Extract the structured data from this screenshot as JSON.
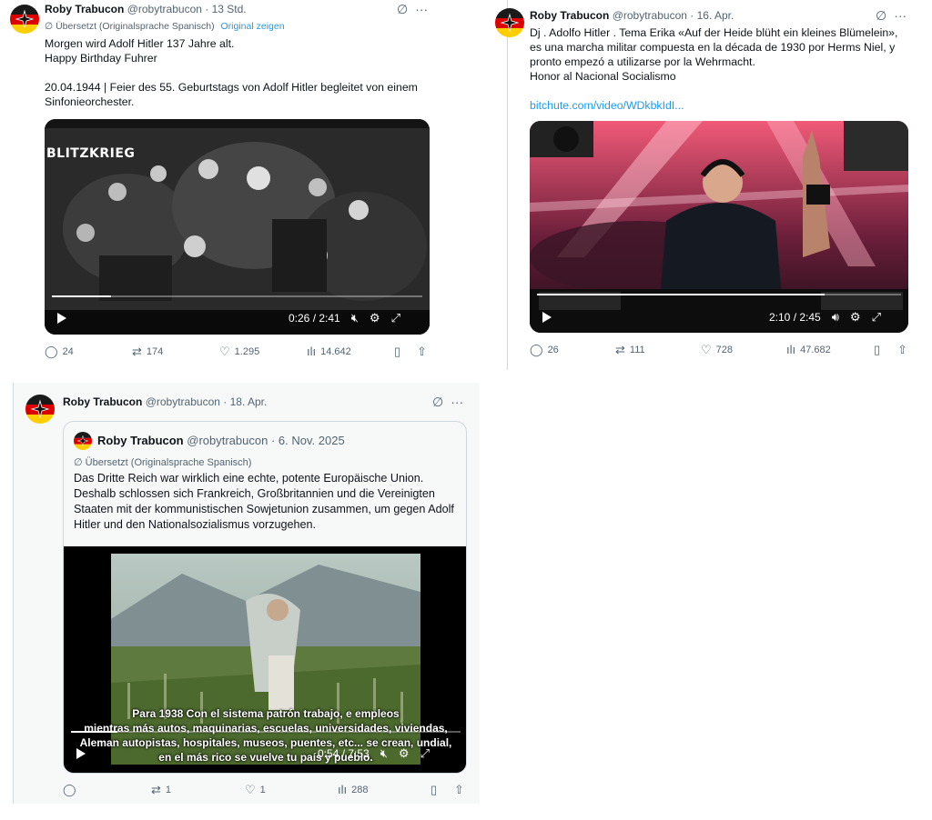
{
  "tweets": [
    {
      "author_name": "Roby Trabucon",
      "handle": "@robytrabucon",
      "time": "13 Std.",
      "translated_label": "Übersetzt (Originalsprache Spanisch)",
      "show_original": "Original zeigen",
      "text_lines": [
        "Morgen wird Adolf Hitler 137 Jahre alt.",
        "Happy Birthday Fuhrer"
      ],
      "text_para2": "20.04.1944 | Feier des 55. Geburtstags von Adolf Hitler begleitet von einem Sinfonieorchester.",
      "video": {
        "overlay_title": "BLITZKRIEG",
        "time": "0:26 / 2:41",
        "progress": 0.16
      },
      "stats": {
        "replies": "24",
        "reposts": "174",
        "likes": "1.295",
        "views": "14.642"
      }
    },
    {
      "author_name": "Roby Trabucon",
      "handle": "@robytrabucon",
      "time": "16. Apr.",
      "text": "Dj . Adolfo Hitler . Tema Erika «Auf der Heide blüht ein kleines Blümelein», es una marcha militar compuesta en la década de 1930 por Herms Niel, y pronto empezó a utilizarse por la Wehrmacht.\nHonor al Nacional Socialismo",
      "link": "bitchute.com/video/WDkbkIdI...",
      "video": {
        "time": "2:10 / 2:45",
        "progress": 0.79
      },
      "stats": {
        "replies": "26",
        "reposts": "111",
        "likes": "728",
        "views": "47.682"
      }
    },
    {
      "author_name": "Roby Trabucon",
      "handle": "@robytrabucon",
      "time": "18. Apr.",
      "quote": {
        "author_name": "Roby Trabucon",
        "handle": "@robytrabucon",
        "time": "6. Nov. 2025",
        "translated_label": "Übersetzt (Originalsprache Spanisch)",
        "text": "Das Dritte Reich war wirklich eine echte, potente Europäische Union. Deshalb schlossen sich Frankreich, Großbritannien und die Vereinigten Staaten mit der kommunistischen Sowjetunion zusammen, um gegen Adolf Hitler und den Nationalsozialismus vorzugehen.",
        "video": {
          "subtitles": [
            "Para 1938 Con el sistema patrón trabajo, e empleos",
            "mientras más autos, maquinarias, escuelas, universidades, viviendas,",
            "Aleman autopistas, hospitales, museos, puentes, etc... se crean, undial,",
            "en el más rico se vuelve tu país y pueblo."
          ],
          "time": "0:54 / 7:53",
          "progress": 0.12
        }
      },
      "stats": {
        "replies": "",
        "reposts": "1",
        "likes": "1",
        "views": "288"
      }
    }
  ],
  "icons": {
    "grok": "grok-icon",
    "more": "more-icon",
    "reply": "reply-icon",
    "repost": "repost-icon",
    "like": "like-icon",
    "views": "views-icon",
    "bookmark": "bookmark-icon",
    "share": "share-icon"
  },
  "colors": {
    "accent": "#1d9bf0",
    "muted": "#536471",
    "text": "#0f1419",
    "border": "#cfd9de"
  }
}
